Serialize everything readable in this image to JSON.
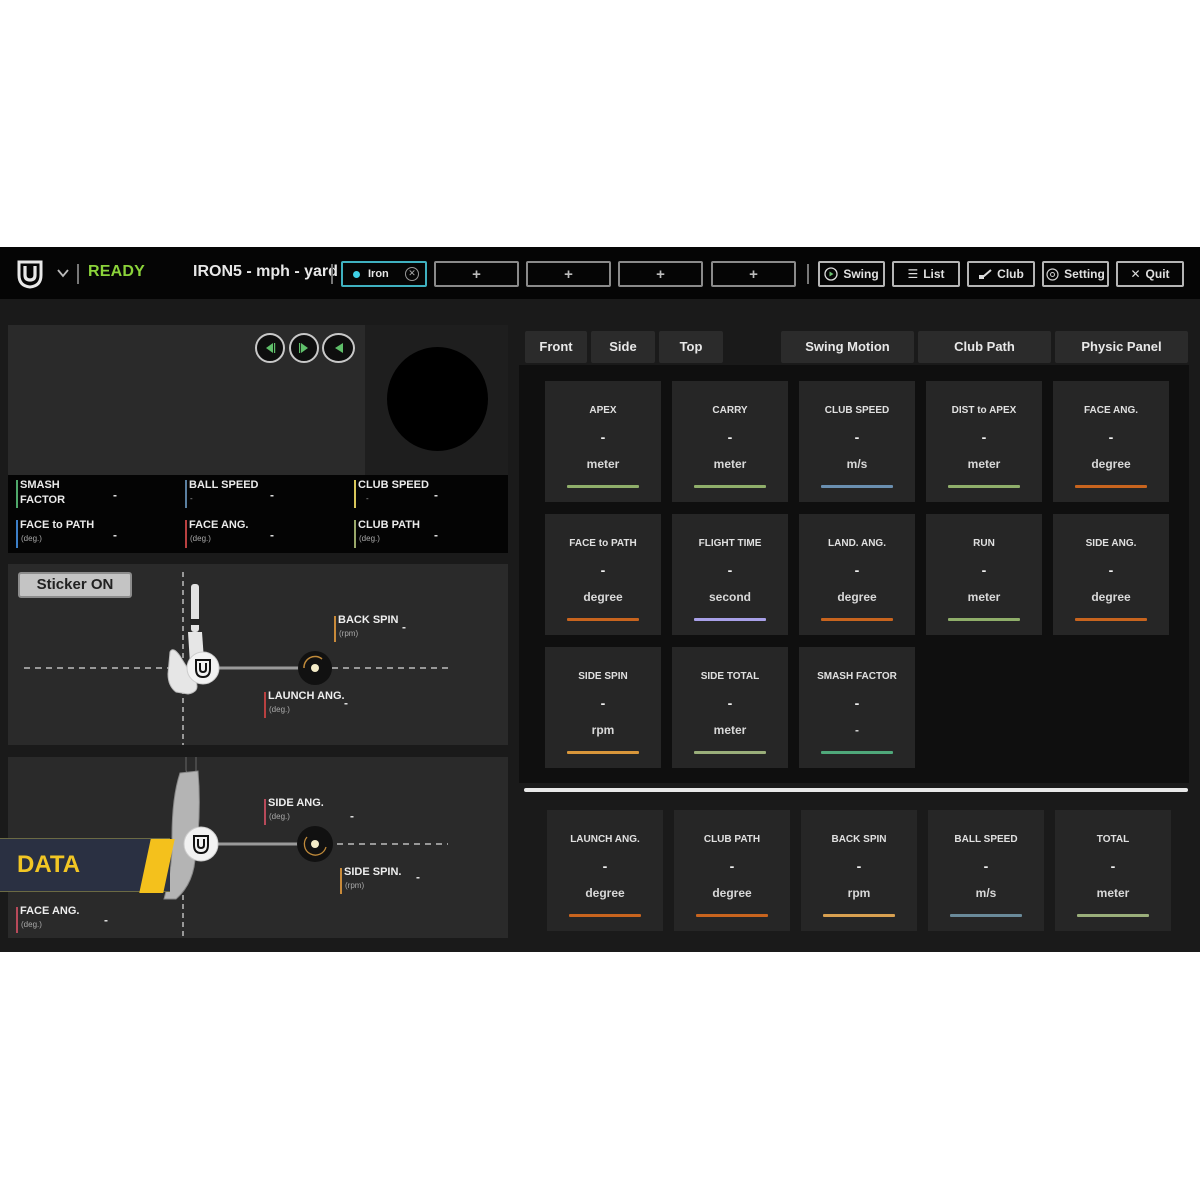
{
  "topbar": {
    "status": "READY",
    "club_title": "IRON5 - mph - yard",
    "slots": [
      {
        "label": "Iron",
        "active": true
      },
      {
        "label": "+",
        "active": false
      },
      {
        "label": "+",
        "active": false
      },
      {
        "label": "+",
        "active": false
      },
      {
        "label": "+",
        "active": false
      }
    ],
    "buttons": [
      {
        "label": "Swing",
        "icon": "play-circle-icon",
        "glyph": "▶"
      },
      {
        "label": "List",
        "icon": "list-icon",
        "glyph": "☰"
      },
      {
        "label": "Club",
        "icon": "club-icon",
        "glyph": "⌐"
      },
      {
        "label": "Setting",
        "icon": "gear-icon",
        "glyph": "⚙"
      },
      {
        "label": "Quit",
        "icon": "close-icon",
        "glyph": "✕"
      }
    ]
  },
  "viewer": {
    "controls": [
      "previous",
      "play",
      "rewind"
    ]
  },
  "summary_stats": [
    {
      "name": "SMASH\nFACTOR",
      "unit": "",
      "value": "-",
      "color": "#4fa86a"
    },
    {
      "name": "BALL SPEED",
      "unit": "-",
      "value": "-",
      "color": "#5a7fa0"
    },
    {
      "name": "CLUB SPEED",
      "unit": "-",
      "value": "-",
      "color": "#d8c65a"
    },
    {
      "name": "FACE to PATH",
      "unit": "(deg.)",
      "value": "-",
      "color": "#3c7fc8"
    },
    {
      "name": "FACE ANG.",
      "unit": "(deg.)",
      "value": "-",
      "color": "#b84040"
    },
    {
      "name": "CLUB PATH",
      "unit": "(deg.)",
      "value": "-",
      "color": "#9aa86a"
    }
  ],
  "side_view": {
    "sticker_label": "Sticker ON",
    "back_spin": {
      "name": "BACK SPIN",
      "unit": "(rpm)",
      "value": "-",
      "color": "#c88a3a"
    },
    "launch_ang": {
      "name": "LAUNCH ANG.",
      "unit": "(deg.)",
      "value": "-",
      "color": "#b84040"
    }
  },
  "top_view": {
    "banner": "DATA",
    "side_ang": {
      "name": "SIDE ANG.",
      "unit": "(deg.)",
      "value": "-",
      "color": "#b84a5a"
    },
    "side_spin": {
      "name": "SIDE SPIN.",
      "unit": "(rpm)",
      "value": "-",
      "color": "#c88a3a"
    },
    "face_ang": {
      "name": "FACE ANG.",
      "unit": "(deg.)",
      "value": "-",
      "color": "#b84a5a"
    }
  },
  "view_tabs": [
    "Front",
    "Side",
    "Top"
  ],
  "panel_tabs": [
    "Swing Motion",
    "Club Path",
    "Physic Panel"
  ],
  "metrics": [
    {
      "title": "APEX",
      "value": "-",
      "unit": "meter",
      "color": "#8fae6a"
    },
    {
      "title": "CARRY",
      "value": "-",
      "unit": "meter",
      "color": "#8fae6a"
    },
    {
      "title": "CLUB SPEED",
      "value": "-",
      "unit": "m/s",
      "color": "#6a8fb0"
    },
    {
      "title": "DIST to APEX",
      "value": "-",
      "unit": "meter",
      "color": "#8fae6a"
    },
    {
      "title": "FACE ANG.",
      "value": "-",
      "unit": "degree",
      "color": "#c8641e"
    },
    {
      "title": "FACE to PATH",
      "value": "-",
      "unit": "degree",
      "color": "#c8641e"
    },
    {
      "title": "FLIGHT TIME",
      "value": "-",
      "unit": "second",
      "color": "#a8a0e8"
    },
    {
      "title": "LAND. ANG.",
      "value": "-",
      "unit": "degree",
      "color": "#c8641e"
    },
    {
      "title": "RUN",
      "value": "-",
      "unit": "meter",
      "color": "#8fae6a"
    },
    {
      "title": "SIDE ANG.",
      "value": "-",
      "unit": "degree",
      "color": "#c8641e"
    },
    {
      "title": "SIDE SPIN",
      "value": "-",
      "unit": "rpm",
      "color": "#d8963a"
    },
    {
      "title": "SIDE TOTAL",
      "value": "-",
      "unit": "meter",
      "color": "#9aae7a"
    },
    {
      "title": "SMASH FACTOR",
      "value": "-",
      "unit": "-",
      "color": "#4fa87a"
    }
  ],
  "key_metrics": [
    {
      "title": "LAUNCH ANG.",
      "value": "-",
      "unit": "degree",
      "color": "#c8641e"
    },
    {
      "title": "CLUB PATH",
      "value": "-",
      "unit": "degree",
      "color": "#c8641e"
    },
    {
      "title": "BACK SPIN",
      "value": "-",
      "unit": "rpm",
      "color": "#d8a050"
    },
    {
      "title": "BALL SPEED",
      "value": "-",
      "unit": "m/s",
      "color": "#6a8a9a"
    },
    {
      "title": "TOTAL",
      "value": "-",
      "unit": "meter",
      "color": "#9aae7a"
    }
  ]
}
